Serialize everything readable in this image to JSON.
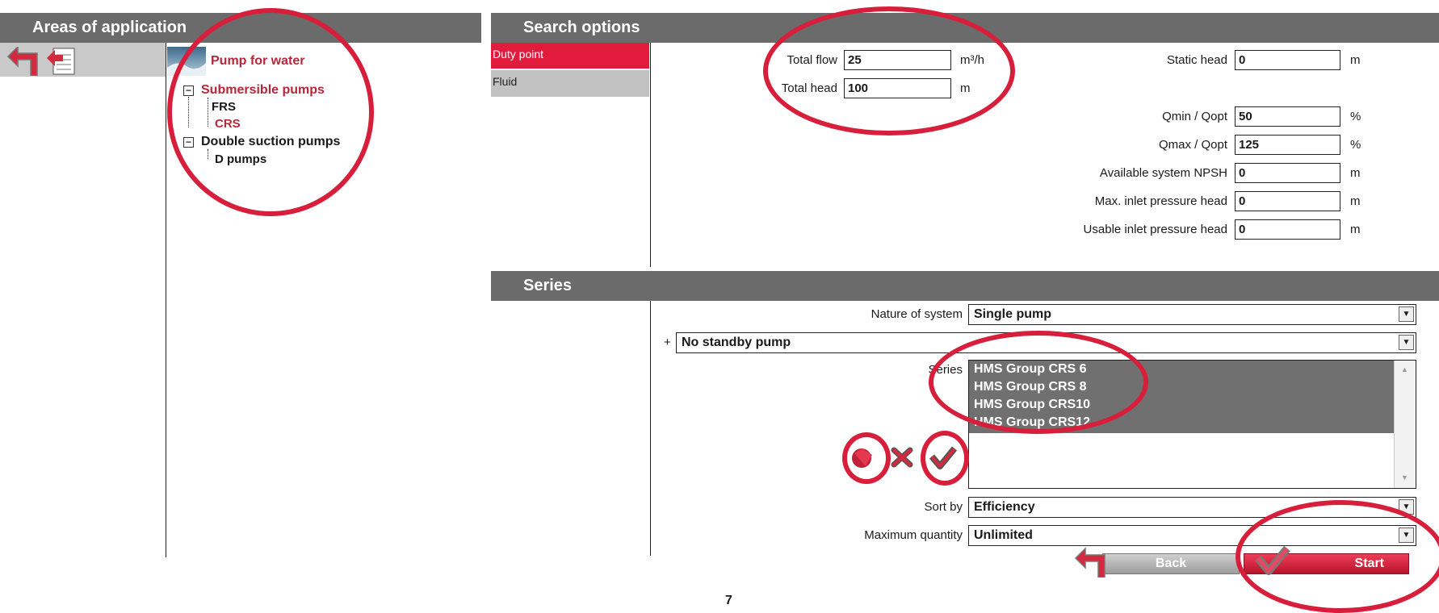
{
  "areas": {
    "title": "Areas of application",
    "root": "Pump for water",
    "groups": [
      {
        "label": "Submersible pumps",
        "children": [
          "FRS",
          "CRS"
        ]
      },
      {
        "label": "Double suction pumps",
        "children": [
          "D pumps"
        ]
      }
    ]
  },
  "search_options": {
    "title": "Search options",
    "tabs": [
      "Duty point",
      "Fluid"
    ],
    "fields": {
      "total_flow": {
        "label": "Total flow",
        "value": "25",
        "unit": "m³/h"
      },
      "total_head": {
        "label": "Total head",
        "value": "100",
        "unit": "m"
      },
      "static_head": {
        "label": "Static head",
        "value": "0",
        "unit": "m"
      },
      "qmin_qopt": {
        "label": "Qmin / Qopt",
        "value": "50",
        "unit": "%"
      },
      "qmax_qopt": {
        "label": "Qmax / Qopt",
        "value": "125",
        "unit": "%"
      },
      "npsh": {
        "label": "Available system NPSH",
        "value": "0",
        "unit": "m"
      },
      "max_inlet": {
        "label": "Max. inlet pressure head",
        "value": "0",
        "unit": "m"
      },
      "usable_inlet": {
        "label": "Usable inlet pressure head",
        "value": "0",
        "unit": "m"
      }
    }
  },
  "series": {
    "title": "Series",
    "nature_label": "Nature of system",
    "nature_value": "Single pump",
    "standby_prefix": "+",
    "standby_value": "No standby pump",
    "series_label": "Series",
    "series_items": [
      "HMS Group CRS 6",
      "HMS Group CRS 8",
      "HMS Group CRS10",
      "HMS Group CRS12"
    ],
    "sort_label": "Sort by",
    "sort_value": "Efficiency",
    "max_qty_label": "Maximum quantity",
    "max_qty_value": "Unlimited",
    "back_label": "Back",
    "start_label": "Start"
  },
  "page_number": "7",
  "colors": {
    "accent": "#e21b3c",
    "header": "#6b6b6b",
    "annotation": "#d71e3a"
  }
}
